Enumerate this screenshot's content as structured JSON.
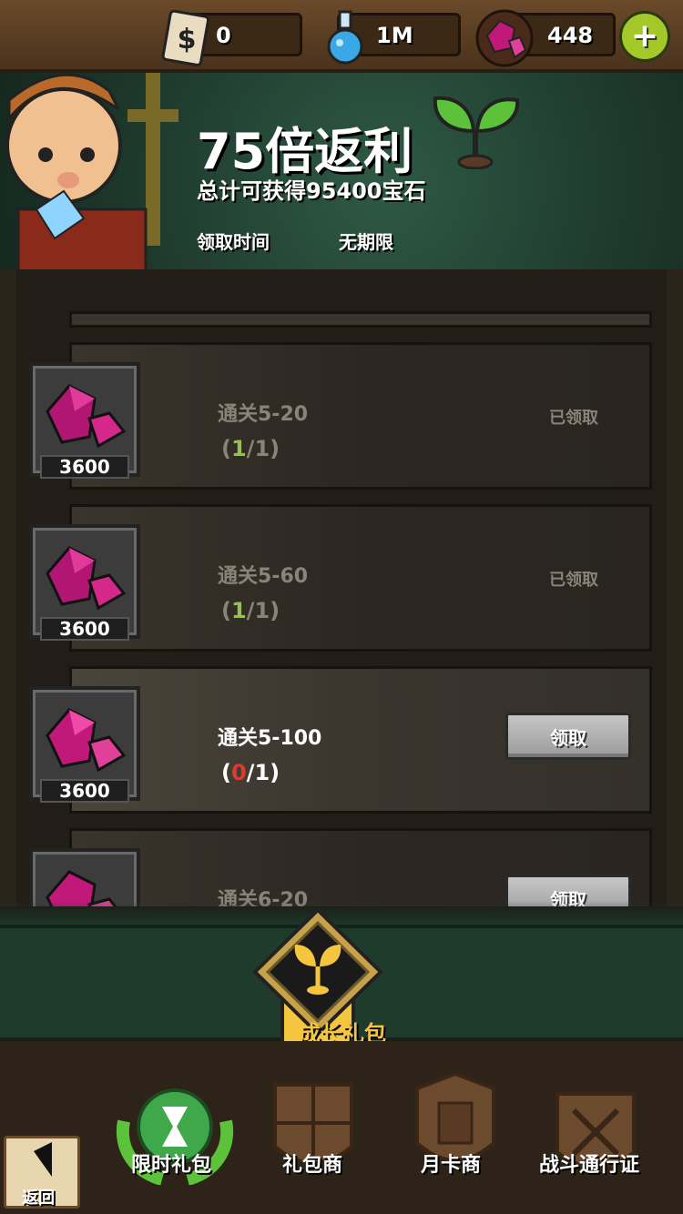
{
  "currencies": [
    {
      "icon": "ticket-dollar-icon",
      "value": "0"
    },
    {
      "icon": "potion-flask-icon",
      "value": "1M"
    },
    {
      "icon": "pink-gem-icon",
      "value": "448"
    }
  ],
  "header": {
    "title": "75倍返利",
    "subtitle": "总计可获得95400宝石",
    "claim_time_label": "领取时间",
    "claim_time_value": "无期限"
  },
  "rows": [
    {
      "title": "通关5-20",
      "progress_open": "(",
      "progress_current": "1",
      "progress_rest": "/1)",
      "status": "已领取",
      "reward": "3600"
    },
    {
      "title": "通关5-60",
      "progress_open": "(",
      "progress_current": "1",
      "progress_rest": "/1)",
      "status": "已领取",
      "reward": "3600"
    },
    {
      "title": "通关5-100",
      "progress_open": "(",
      "progress_current": "0",
      "progress_rest": "/1)",
      "button": "领取",
      "reward": "3600"
    },
    {
      "title": "通关6-20",
      "button": "领取"
    }
  ],
  "badge": {
    "label": "成长礼包"
  },
  "nav": {
    "items": [
      {
        "label": "限时礼包"
      },
      {
        "label": "礼包商"
      },
      {
        "label": "月卡商"
      },
      {
        "label": "战斗通行证"
      }
    ],
    "back_label": "返回"
  },
  "colors": {
    "gem": "#c2187a",
    "progress_done": "#9bbc5b",
    "progress_pending": "#e03a2a",
    "badge_gold": "#f6c540"
  }
}
